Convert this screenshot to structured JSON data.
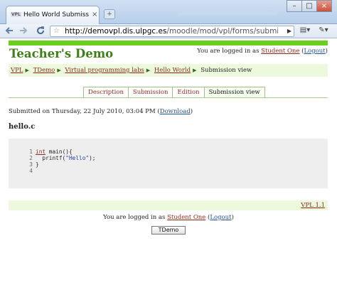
{
  "browser": {
    "tab_favicon": "VPL",
    "tab_title": "Hello World Submission ...",
    "tab_close": "×",
    "new_tab_glyph": "+",
    "window_controls": [
      "–",
      "□",
      "×"
    ],
    "url_domain": "http://demovpl.dis.ulpgc.es",
    "url_path": "/moodle/mod/vpl/forms/submissionvi",
    "icons": [
      "back-icon",
      "forward-icon",
      "reload-icon",
      "star-icon",
      "go-icon",
      "page-menu-icon",
      "tools-menu-icon"
    ]
  },
  "site": {
    "title": "Teacher's Demo",
    "login_prefix": "You are logged in as ",
    "user_name": "Student One",
    "logout_label": "(Logout)",
    "logout_open": "(",
    "logout_text": "Logout",
    "logout_close": ")"
  },
  "breadcrumbs": [
    "VPL",
    "TDemo",
    "Virtual programming labs",
    "Hello World",
    "Submission view"
  ],
  "tabs": [
    "Description",
    "Submission",
    "Edition",
    "Submission view"
  ],
  "submission": {
    "prefix": "Submitted on Thursday, 22 July 2010, 03:04 PM (",
    "download": "Download",
    "suffix": ")",
    "filename": "hello.c"
  },
  "code_lines": [
    {
      "num": "1",
      "kw": "int",
      "rest": " main(){"
    },
    {
      "num": "2",
      "pre": "  printf(",
      "str": "\"Hello\"",
      "post": ");"
    },
    {
      "num": "3",
      "rest": "}"
    },
    {
      "num": "4",
      "rest": ""
    }
  ],
  "footer": {
    "version": "VPL 1.1",
    "home_button": "TDemo"
  },
  "colors": {
    "site_green": "#3f7f1a",
    "bar_green": "#6dcf1d",
    "link_red": "#8a2a1d",
    "link_blue": "#1f4f8f"
  }
}
